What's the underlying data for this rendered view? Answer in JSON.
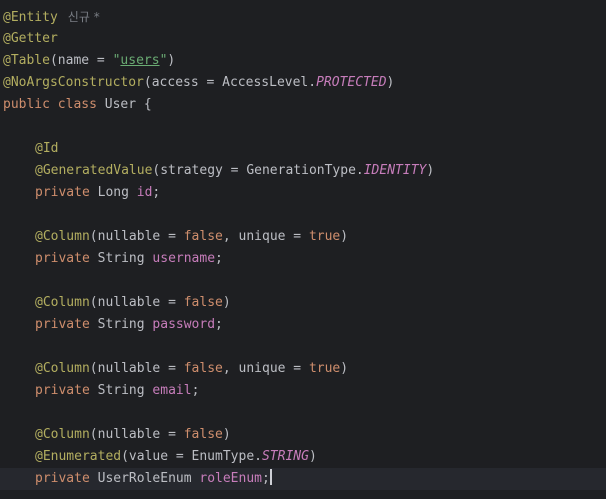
{
  "editor": {
    "header": {
      "entity": "@Entity",
      "hint": "신규 *",
      "getter": "@Getter",
      "table_ann": "@Table",
      "table_open": "(name = ",
      "table_q1": "\"",
      "table_value": "users",
      "table_q2": "\"",
      "table_close": ")",
      "noargs_ann": "@NoArgsConstructor",
      "noargs_open": "(access = AccessLevel.",
      "noargs_const": "PROTECTED",
      "noargs_close": ")",
      "class_kw": "public class ",
      "class_name": "User {"
    },
    "id_block": {
      "id_ann": "@Id",
      "gen_ann": "@GeneratedValue",
      "gen_open": "(strategy = GenerationType.",
      "gen_const": "IDENTITY",
      "gen_close": ")",
      "decl_kw": "private ",
      "decl_type": "Long ",
      "decl_field": "id",
      "decl_end": ";"
    },
    "username_block": {
      "col_ann": "@Column",
      "col_open": "(nullable = ",
      "col_false": "false",
      "col_mid": ", unique = ",
      "col_true": "true",
      "col_close": ")",
      "decl_kw": "private ",
      "decl_type": "String ",
      "decl_field": "username",
      "decl_end": ";"
    },
    "password_block": {
      "col_ann": "@Column",
      "col_open": "(nullable = ",
      "col_false": "false",
      "col_close": ")",
      "decl_kw": "private ",
      "decl_type": "String ",
      "decl_field": "password",
      "decl_end": ";"
    },
    "email_block": {
      "col_ann": "@Column",
      "col_open": "(nullable = ",
      "col_false": "false",
      "col_mid": ", unique = ",
      "col_true": "true",
      "col_close": ")",
      "decl_kw": "private ",
      "decl_type": "String ",
      "decl_field": "email",
      "decl_end": ";"
    },
    "role_block": {
      "col_ann": "@Column",
      "col_open": "(nullable = ",
      "col_false": "false",
      "col_close": ")",
      "enum_ann": "@Enumerated",
      "enum_open": "(value = EnumType.",
      "enum_const": "STRING",
      "enum_close": ")",
      "decl_kw": "private ",
      "decl_type": "UserRoleEnum ",
      "decl_field": "roleEnum",
      "decl_end": ";"
    },
    "colors": {
      "background": "#1e1f22",
      "current_line": "#26282e",
      "annotation": "#b3ae60",
      "keyword": "#cf8e6d",
      "string": "#6aab73",
      "field": "#c77dbb",
      "text": "#bcbec4"
    }
  }
}
